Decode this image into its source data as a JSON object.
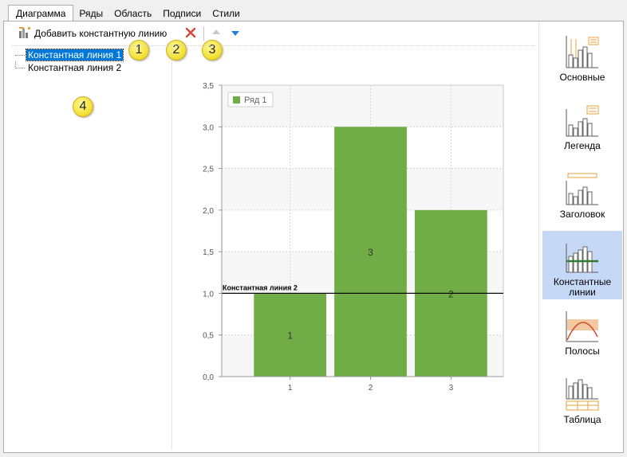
{
  "tabs": [
    {
      "label": "Диаграмма",
      "active": true
    },
    {
      "label": "Ряды",
      "active": false
    },
    {
      "label": "Область",
      "active": false
    },
    {
      "label": "Подписи",
      "active": false
    },
    {
      "label": "Стили",
      "active": false
    }
  ],
  "toolbar": {
    "add_label": "Добавить константную линию"
  },
  "badges": [
    "1",
    "2",
    "3",
    "4"
  ],
  "tree": {
    "items": [
      "Константная линия 1",
      "Константная линия 2"
    ],
    "selected_index": 0
  },
  "sidebar": {
    "items": [
      {
        "label": "Основные",
        "icon": "basic-chart-icon"
      },
      {
        "label": "Легенда",
        "icon": "legend-chart-icon"
      },
      {
        "label": "Заголовок",
        "icon": "title-chart-icon"
      },
      {
        "label": "Константные линии",
        "icon": "constant-lines-chart-icon",
        "active": true
      },
      {
        "label": "Полосы",
        "icon": "strips-chart-icon"
      },
      {
        "label": "Таблица",
        "icon": "table-chart-icon"
      }
    ]
  },
  "chart_data": {
    "type": "bar",
    "categories": [
      "1",
      "2",
      "3"
    ],
    "values": [
      1,
      3,
      2
    ],
    "series": [
      {
        "name": "Ряд 1",
        "values": [
          1,
          3,
          2
        ],
        "color": "#70ad47"
      }
    ],
    "data_labels": [
      "1",
      "3",
      "2"
    ],
    "ylim": [
      0,
      3.5
    ],
    "yticks": [
      "0,0",
      "0,5",
      "1,0",
      "1,5",
      "2,0",
      "2,5",
      "3,0",
      "3,5"
    ],
    "constant_lines": [
      {
        "name": "Константная линия 1",
        "value": 1.0
      },
      {
        "name": "Константная линия 2",
        "value": 1.0
      }
    ],
    "constant_line_label": "Константная линия 2",
    "legend_position": "top-left",
    "grid": true,
    "colors": {
      "bar": "#70ad47",
      "plot_bg": "#f7f7f7",
      "alt_band": "#ffffff",
      "grid": "#d3d3d3"
    }
  }
}
